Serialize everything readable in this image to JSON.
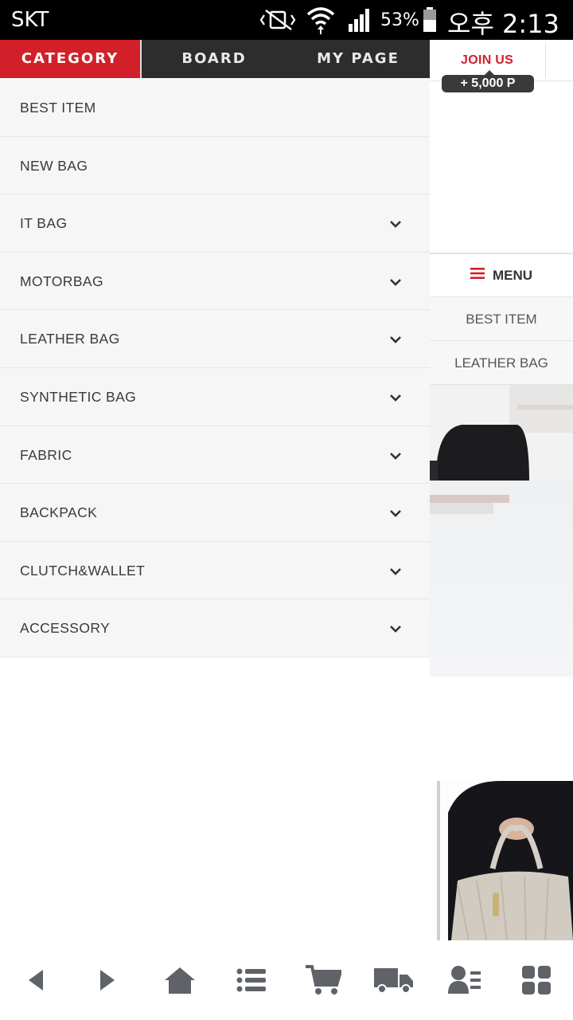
{
  "status_bar": {
    "carrier": "SKT",
    "battery_percent": "53%",
    "time": "오후 2:13",
    "icons": [
      "vibrate-mute-icon",
      "wifi-icon",
      "signal-icon",
      "battery-icon"
    ]
  },
  "drawer": {
    "tabs": [
      {
        "label": "CATEGORY",
        "active": true
      },
      {
        "label": "BOARD",
        "active": false
      },
      {
        "label": "MY PAGE",
        "active": false
      }
    ],
    "categories": [
      {
        "label": "BEST ITEM",
        "expandable": false
      },
      {
        "label": "NEW BAG",
        "expandable": false
      },
      {
        "label": "IT BAG",
        "expandable": true
      },
      {
        "label": "MOTORBAG",
        "expandable": true
      },
      {
        "label": "LEATHER BAG",
        "expandable": true
      },
      {
        "label": "SYNTHETIC BAG",
        "expandable": true
      },
      {
        "label": "FABRIC",
        "expandable": true
      },
      {
        "label": "BACKPACK",
        "expandable": true
      },
      {
        "label": "CLUTCH&WALLET",
        "expandable": true
      },
      {
        "label": "ACCESSORY",
        "expandable": true
      }
    ]
  },
  "page": {
    "join_label": "JOIN US",
    "points_badge": "+ 5,000 P",
    "menu_label": "MENU",
    "side_items": [
      "BEST ITEM",
      "LEATHER BAG"
    ]
  },
  "bottom_nav": {
    "buttons": [
      "back-icon",
      "forward-icon",
      "home-icon",
      "list-icon",
      "cart-icon",
      "delivery-truck-icon",
      "my-account-icon",
      "grid-menu-icon"
    ]
  },
  "colors": {
    "accent": "#d1202a",
    "tab_bar": "#2d2d2d",
    "drawer_bg": "#f6f6f6",
    "icon_gray": "#5f6368"
  }
}
